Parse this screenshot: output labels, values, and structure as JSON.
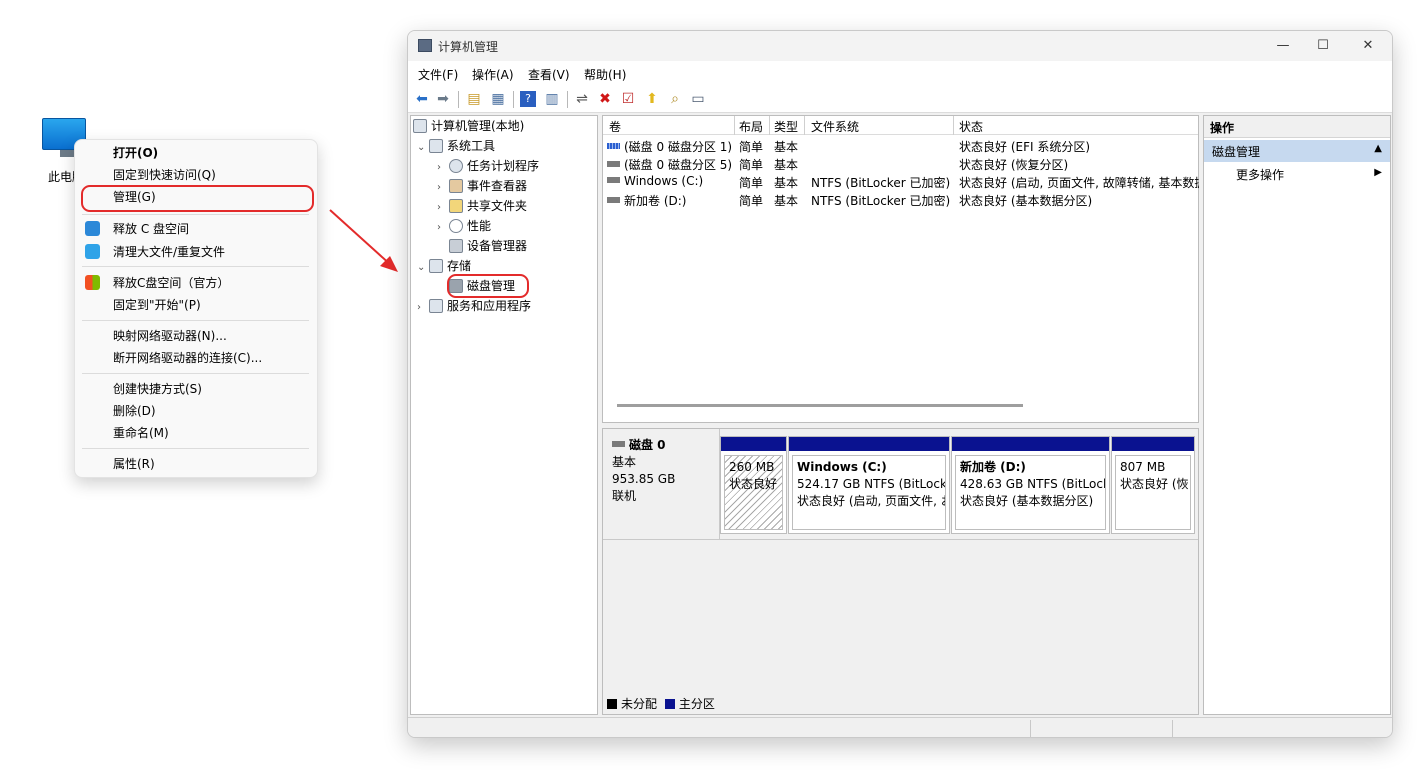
{
  "desktop": {
    "icon_label": "此电脑"
  },
  "context_menu": {
    "items": [
      {
        "label": "打开(O)"
      },
      {
        "label": "固定到快速访问(Q)"
      },
      {
        "label": "管理(G)"
      },
      {
        "label": "释放 C 盘空间"
      },
      {
        "label": "清理大文件/重复文件"
      },
      {
        "label": "释放C盘空间（官方）"
      },
      {
        "label": "固定到\"开始\"(P)"
      },
      {
        "label": "映射网络驱动器(N)..."
      },
      {
        "label": "断开网络驱动器的连接(C)..."
      },
      {
        "label": "创建快捷方式(S)"
      },
      {
        "label": "删除(D)"
      },
      {
        "label": "重命名(M)"
      },
      {
        "label": "属性(R)"
      }
    ]
  },
  "window": {
    "title": "计算机管理",
    "controls": {
      "minimize": "—",
      "maximize": "☐",
      "close": "✕"
    },
    "menus": [
      "文件(F)",
      "操作(A)",
      "查看(V)",
      "帮助(H)"
    ],
    "tree": {
      "root": "计算机管理(本地)",
      "system_tools": "系统工具",
      "task_scheduler": "任务计划程序",
      "event_viewer": "事件查看器",
      "shared_folders": "共享文件夹",
      "performance": "性能",
      "device_manager": "设备管理器",
      "storage": "存储",
      "disk_management": "磁盘管理",
      "services_apps": "服务和应用程序"
    },
    "volume_columns": [
      "卷",
      "布局",
      "类型",
      "文件系统",
      "状态"
    ],
    "volumes": [
      {
        "name": "(磁盘 0 磁盘分区 1)",
        "layout": "简单",
        "type": "基本",
        "fs": "",
        "status": "状态良好 (EFI 系统分区)"
      },
      {
        "name": "(磁盘 0 磁盘分区 5)",
        "layout": "简单",
        "type": "基本",
        "fs": "",
        "status": "状态良好 (恢复分区)"
      },
      {
        "name": "Windows (C:)",
        "layout": "简单",
        "type": "基本",
        "fs": "NTFS (BitLocker 已加密)",
        "status": "状态良好 (启动, 页面文件, 故障转储, 基本数据"
      },
      {
        "name": "新加卷 (D:)",
        "layout": "简单",
        "type": "基本",
        "fs": "NTFS (BitLocker 已加密)",
        "status": "状态良好 (基本数据分区)"
      }
    ],
    "disk": {
      "name": "磁盘 0",
      "kind": "基本",
      "size": "953.85 GB",
      "state": "联机",
      "partitions": [
        {
          "title": "",
          "line1": "260 MB",
          "line2": "状态良好"
        },
        {
          "title": "Windows  (C:)",
          "line1": "524.17 GB NTFS (BitLocke",
          "line2": "状态良好 (启动, 页面文件, お"
        },
        {
          "title": "新加卷  (D:)",
          "line1": "428.63 GB NTFS (BitLock",
          "line2": "状态良好 (基本数据分区)"
        },
        {
          "title": "",
          "line1": "807 MB",
          "line2": "状态良好 (恢"
        }
      ]
    },
    "legend": [
      {
        "label": "未分配",
        "color": "#000000"
      },
      {
        "label": "主分区",
        "color": "#0a1290"
      }
    ],
    "actions": {
      "header": "操作",
      "selected": "磁盘管理",
      "more": "更多操作"
    }
  },
  "colors": {
    "highlight_red": "#e32b2b",
    "partition_bar": "#0a1290",
    "action_selected": "#c6d9ef"
  }
}
